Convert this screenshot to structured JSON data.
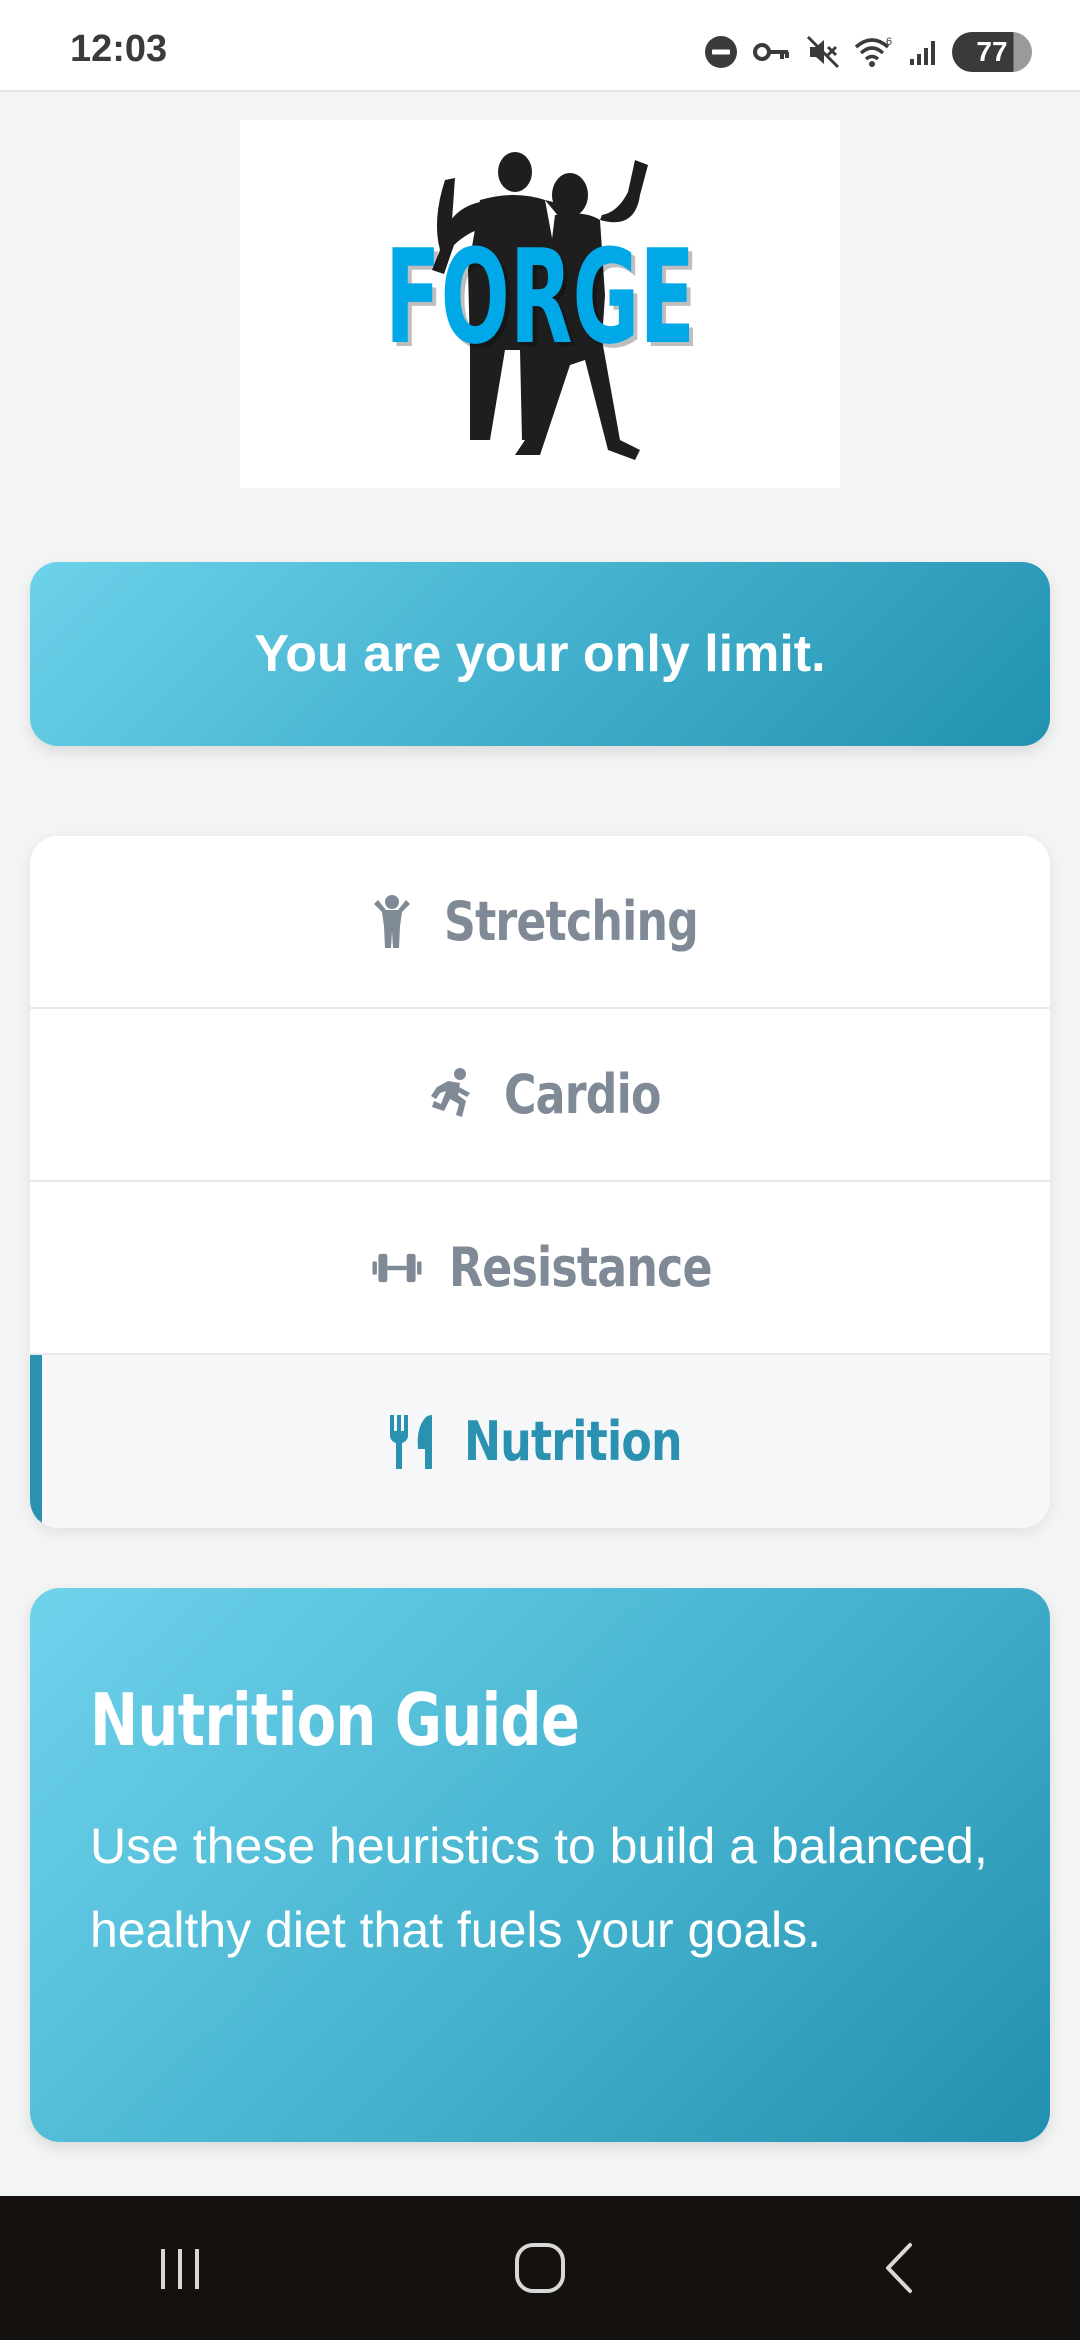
{
  "status_bar": {
    "time": "12:03",
    "battery_level": "77",
    "icons": [
      "do-not-disturb-icon",
      "vpn-key-icon",
      "mute-icon",
      "wifi-icon",
      "signal-icon",
      "battery-icon"
    ]
  },
  "logo": {
    "text": "FORGE",
    "text_color": "#00a8e8"
  },
  "quote": {
    "text": "You are your only limit."
  },
  "menu": {
    "items": [
      {
        "label": "Stretching",
        "icon": "stretching-figure-icon",
        "active": false
      },
      {
        "label": "Cardio",
        "icon": "running-figure-icon",
        "active": false
      },
      {
        "label": "Resistance",
        "icon": "dumbbell-icon",
        "active": false
      },
      {
        "label": "Nutrition",
        "icon": "utensils-icon",
        "active": true
      }
    ],
    "active_color": "#2a91b0",
    "inactive_color": "#7f8a96"
  },
  "guide": {
    "title": "Nutrition Guide",
    "text": "Use these heuristics to build a balanced, healthy diet that fuels your goals."
  },
  "nav_bar": {
    "buttons": [
      "recent-apps-icon",
      "home-icon",
      "back-icon"
    ]
  }
}
